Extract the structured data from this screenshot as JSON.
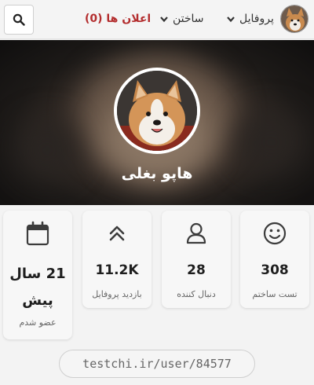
{
  "nav": {
    "announcements_label": "اعلان ها (0)",
    "build_label": "ساختن",
    "profile_label": "پروفایل",
    "search_icon": "search-icon",
    "announcement_color": "#b32d2e"
  },
  "profile": {
    "username": "هاپو بغلی"
  },
  "stats": [
    {
      "icon": "smiley-icon",
      "value": "308",
      "label": "تست ساختم"
    },
    {
      "icon": "user-icon",
      "value": "28",
      "label": "دنبال کننده"
    },
    {
      "icon": "double-chevron-up-icon",
      "value": "11.2K",
      "label": "بازدید پروفایل"
    },
    {
      "icon": "calendar-icon",
      "value": "21 سال پیش",
      "label": "عضو شدم"
    }
  ],
  "profile_url": "testchi.ir/user/84577"
}
